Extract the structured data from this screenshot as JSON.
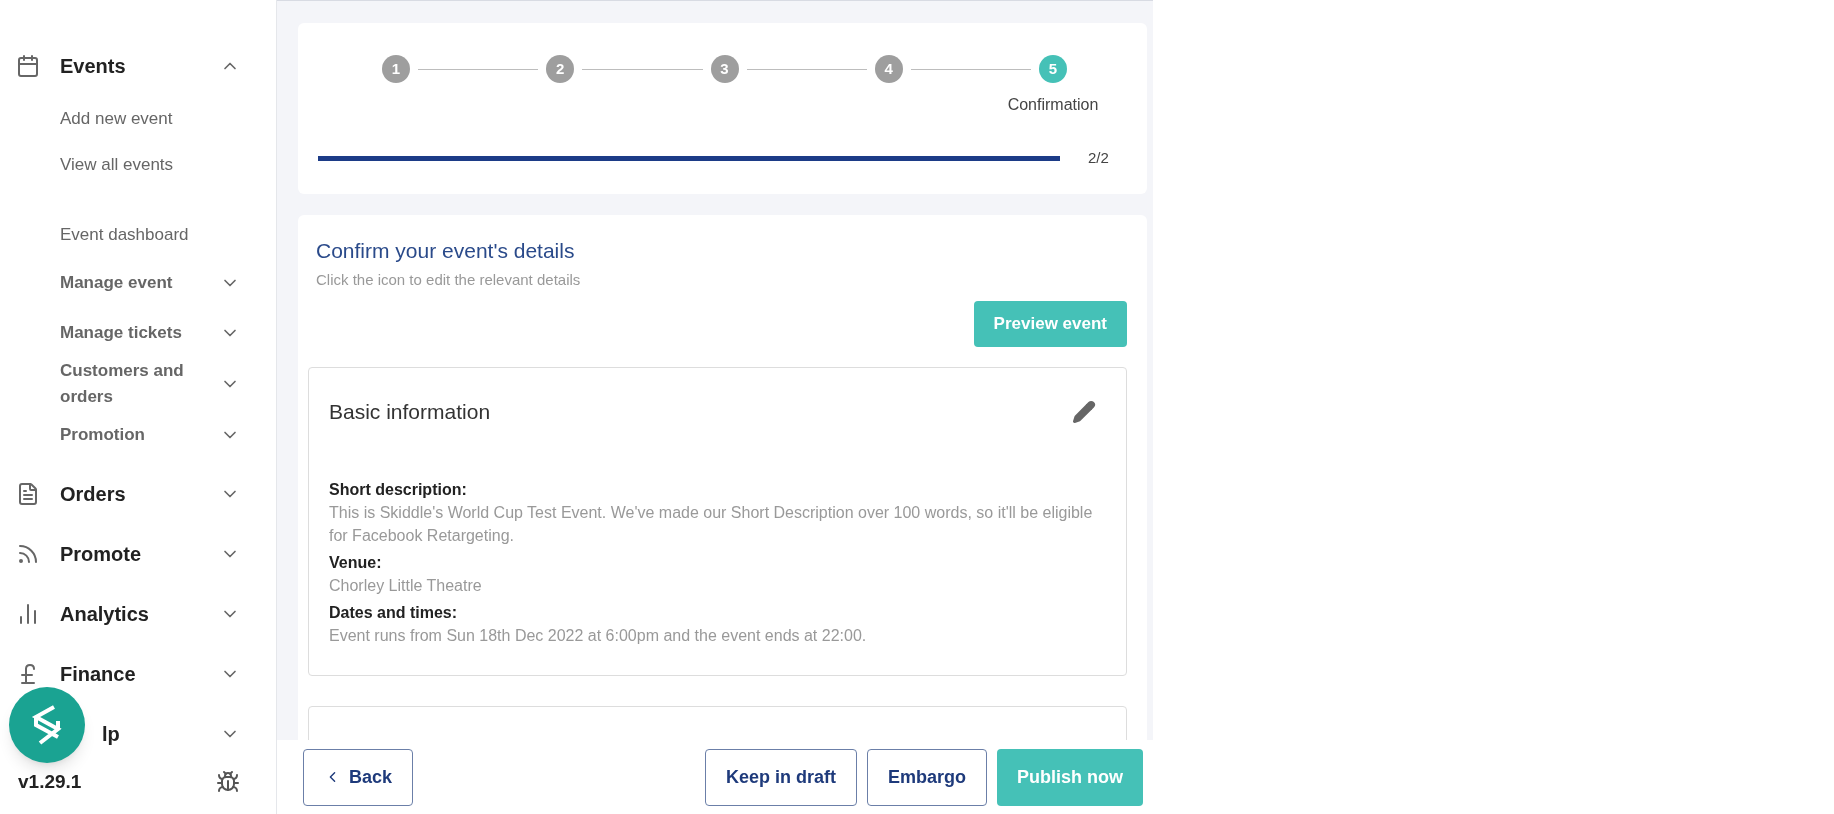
{
  "sidebar": {
    "items": [
      {
        "label": "Events",
        "expanded": true,
        "children": [
          {
            "label": "Add new event",
            "kind": "link"
          },
          {
            "label": "View all events",
            "kind": "link"
          },
          {
            "label": "Event dashboard",
            "kind": "link",
            "spaced": true
          },
          {
            "label": "Manage event",
            "kind": "menu",
            "expanded": false
          },
          {
            "label": "Manage tickets",
            "kind": "menu",
            "expanded": false
          },
          {
            "label": "Customers and orders",
            "kind": "menu",
            "expanded": false
          },
          {
            "label": "Promotion",
            "kind": "menu",
            "expanded": false
          }
        ]
      },
      {
        "label": "Orders",
        "expanded": false
      },
      {
        "label": "Promote",
        "expanded": false
      },
      {
        "label": "Analytics",
        "expanded": false
      },
      {
        "label": "Finance",
        "expanded": false
      },
      {
        "label": "lp",
        "expanded": false
      }
    ],
    "version": "v1.29.1"
  },
  "stepper": {
    "steps": [
      {
        "number": "1",
        "selected": false
      },
      {
        "number": "2",
        "selected": false
      },
      {
        "number": "3",
        "selected": false
      },
      {
        "number": "4",
        "selected": false
      },
      {
        "number": "5",
        "selected": true,
        "label": "Confirmation"
      }
    ],
    "progress": {
      "level": 1,
      "reading": "2/2"
    }
  },
  "confirm": {
    "title": "Confirm your event's details",
    "subtitle": "Click the icon to edit the relevant details",
    "preview_button": "Preview event",
    "sections": [
      {
        "title": "Basic information",
        "fields": [
          {
            "label": "Short description:",
            "value": "This is Skiddle's World Cup Test Event. We've made our Short Description over 100 words, so it'll be eligible for Facebook Retargeting."
          },
          {
            "label": "Venue:",
            "value": "Chorley Little Theatre"
          },
          {
            "label": "Dates and times:",
            "value": "Event runs from Sun 18th Dec 2022 at 6:00pm and the event ends at 22:00."
          }
        ]
      }
    ]
  },
  "footer": {
    "back": "Back",
    "buttons": [
      "Keep in draft",
      "Embargo"
    ],
    "publish": "Publish now"
  }
}
